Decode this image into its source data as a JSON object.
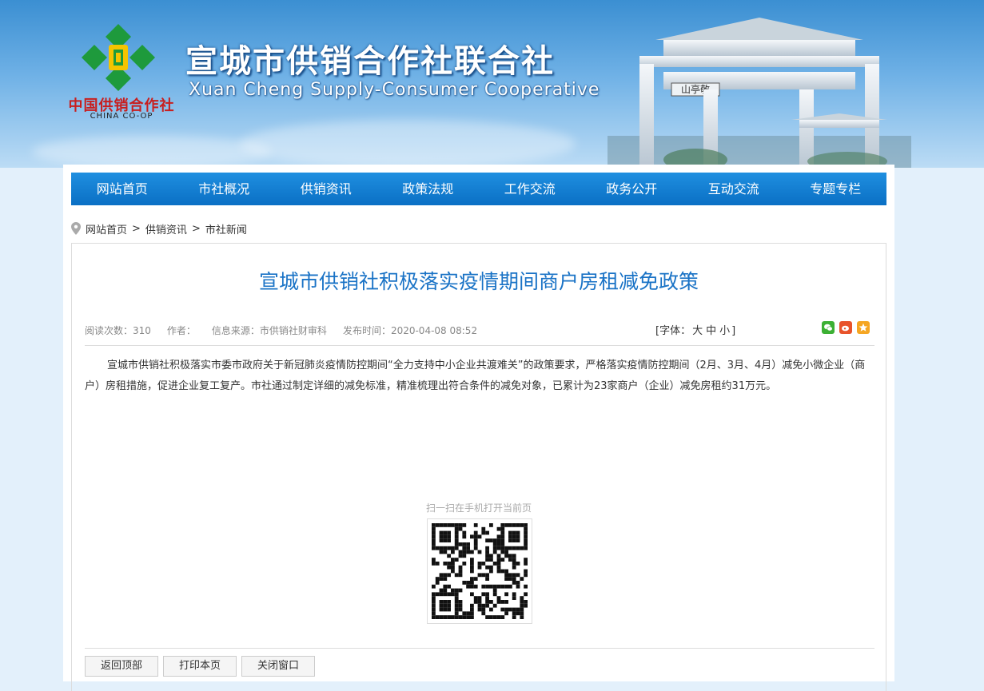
{
  "header": {
    "site_title": "宣城市供销合作社联合社",
    "site_subtitle": "Xuan Cheng Supply-Consumer Cooperative",
    "logo_cn": "中国供销合作社",
    "logo_en": "CHINA CO-OP",
    "gate_plaque": "山亭敬"
  },
  "nav": {
    "items": [
      "网站首页",
      "市社概况",
      "供销资讯",
      "政策法规",
      "工作交流",
      "政务公开",
      "互动交流",
      "专题专栏"
    ]
  },
  "breadcrumb": {
    "items": [
      "网站首页",
      "供销资讯",
      "市社新闻"
    ],
    "separator": ">"
  },
  "article": {
    "title": "宣城市供销社积极落实疫情期间商户房租减免政策",
    "meta": {
      "views": "阅读次数：310",
      "author": "作者：",
      "source": "信息来源：市供销社财审科",
      "published": "发布时间：2020-04-08 08:52"
    },
    "font_size": {
      "prefix": "[字体：",
      "large": "大",
      "medium": "中",
      "small": "小",
      "suffix": "]"
    },
    "share_icons": [
      "wechat-icon",
      "weibo-icon",
      "qzone-icon"
    ],
    "body": "宣城市供销社积极落实市委市政府关于新冠肺炎疫情防控期间“全力支持中小企业共渡难关”的政策要求，严格落实疫情防控期间（2月、3月、4月）减免小微企业（商户）房租措施，促进企业复工复产。市社通过制定详细的减免标准，精准梳理出符合条件的减免对象，已累计为23家商户（企业）减免房租约31万元。",
    "qr_label": "扫一扫在手机打开当前页"
  },
  "actions": {
    "back_top": "返回顶部",
    "print": "打印本页",
    "close": "关闭窗口"
  },
  "colors": {
    "nav_bg": "#0a6fc4",
    "title_blue": "#1a73c6",
    "logo_green": "#1e9a3c",
    "logo_red": "#c81e1e",
    "page_bg": "#e3f0fb"
  }
}
